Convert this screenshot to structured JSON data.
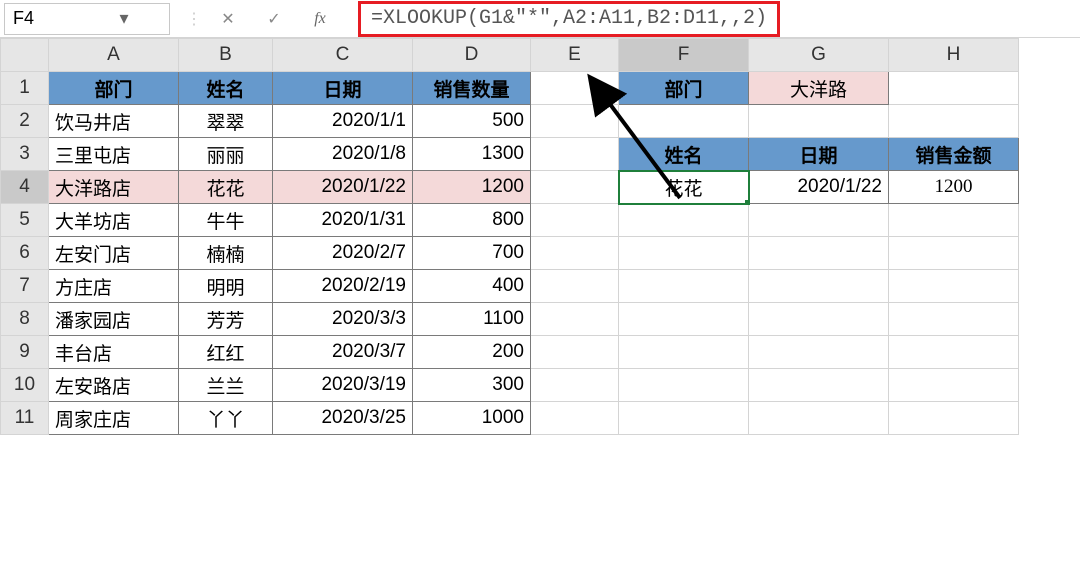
{
  "name_box": {
    "value": "F4"
  },
  "formula_bar": {
    "formula": "=XLOOKUP(G1&\"*\",A2:A11,B2:D11,,2)",
    "fx_label": "fx"
  },
  "columns": [
    "A",
    "B",
    "C",
    "D",
    "E",
    "F",
    "G",
    "H"
  ],
  "row_numbers": [
    1,
    2,
    3,
    4,
    5,
    6,
    7,
    8,
    9,
    10,
    11
  ],
  "main_table": {
    "headers": [
      "部门",
      "姓名",
      "日期",
      "销售数量"
    ],
    "rows": [
      [
        "饮马井店",
        "翠翠",
        "2020/1/1",
        "500"
      ],
      [
        "三里屯店",
        "丽丽",
        "2020/1/8",
        "1300"
      ],
      [
        "大洋路店",
        "花花",
        "2020/1/22",
        "1200"
      ],
      [
        "大羊坊店",
        "牛牛",
        "2020/1/31",
        "800"
      ],
      [
        "左安门店",
        "楠楠",
        "2020/2/7",
        "700"
      ],
      [
        "方庄店",
        "明明",
        "2020/2/19",
        "400"
      ],
      [
        "潘家园店",
        "芳芳",
        "2020/3/3",
        "1100"
      ],
      [
        "丰台店",
        "红红",
        "2020/3/7",
        "200"
      ],
      [
        "左安路店",
        "兰兰",
        "2020/3/19",
        "300"
      ],
      [
        "周家庄店",
        "丫丫",
        "2020/3/25",
        "1000"
      ]
    ],
    "highlighted_row_index": 2
  },
  "lookup_box": {
    "label": "部门",
    "value": "大洋路"
  },
  "result_table": {
    "headers": [
      "姓名",
      "日期",
      "销售金额"
    ],
    "row": [
      "花花",
      "2020/1/22",
      "1200"
    ]
  },
  "icons": {
    "cancel": "✕",
    "confirm": "✓",
    "dropdown": "▾"
  },
  "colors": {
    "header_blue": "#6699cc",
    "highlight_pink": "#f4d9d9",
    "selection_green": "#1f7f3b",
    "formula_box_red": "#e61c23"
  },
  "chart_data": {
    "type": "table",
    "title": "XLOOKUP wildcard example",
    "lookup_formula": "=XLOOKUP(G1&\"*\",A2:A11,B2:D11,,2)",
    "source_headers": [
      "部门",
      "姓名",
      "日期",
      "销售数量"
    ],
    "source_rows": [
      [
        "饮马井店",
        "翠翠",
        "2020/1/1",
        500
      ],
      [
        "三里屯店",
        "丽丽",
        "2020/1/8",
        1300
      ],
      [
        "大洋路店",
        "花花",
        "2020/1/22",
        1200
      ],
      [
        "大羊坊店",
        "牛牛",
        "2020/1/31",
        800
      ],
      [
        "左安门店",
        "楠楠",
        "2020/2/7",
        700
      ],
      [
        "方庄店",
        "明明",
        "2020/2/19",
        400
      ],
      [
        "潘家园店",
        "芳芳",
        "2020/3/3",
        1100
      ],
      [
        "丰台店",
        "红红",
        "2020/3/7",
        200
      ],
      [
        "左安路店",
        "兰兰",
        "2020/3/19",
        300
      ],
      [
        "周家庄店",
        "丫丫",
        "2020/3/25",
        1000
      ]
    ],
    "lookup_input": {
      "部门": "大洋路"
    },
    "result_headers": [
      "姓名",
      "日期",
      "销售金额"
    ],
    "result_row": [
      "花花",
      "2020/1/22",
      1200
    ]
  }
}
